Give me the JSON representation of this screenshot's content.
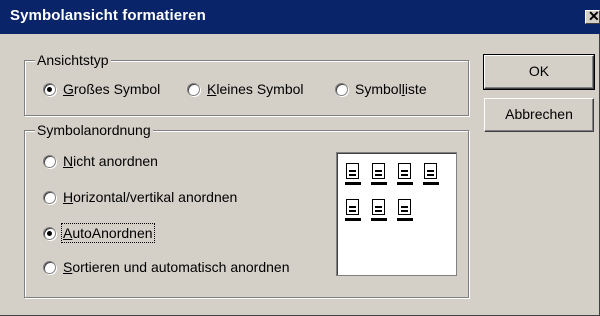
{
  "window": {
    "title": "Symbolansicht formatieren",
    "close_glyph": "✕"
  },
  "view_type": {
    "label": "Ansichtstyp",
    "options": [
      {
        "pre": "",
        "mnemonic": "G",
        "post": "roßes Symbol",
        "checked": true
      },
      {
        "pre": "",
        "mnemonic": "K",
        "post": "leines Symbol",
        "checked": false
      },
      {
        "pre": "Symbol",
        "mnemonic": "l",
        "post": "iste",
        "checked": false
      }
    ]
  },
  "arrangement": {
    "label": "Symbolanordnung",
    "options": [
      {
        "pre": "",
        "mnemonic": "N",
        "post": "icht anordnen",
        "checked": false
      },
      {
        "pre": "",
        "mnemonic": "H",
        "post": "orizontal/vertikal anordnen",
        "checked": false
      },
      {
        "pre": "",
        "mnemonic": "A",
        "post": "utoAnordnen",
        "checked": true
      },
      {
        "pre": "",
        "mnemonic": "S",
        "post": "ortieren und automatisch anordnen",
        "checked": false
      }
    ]
  },
  "buttons": {
    "ok": "OK",
    "cancel": "Abbrechen"
  },
  "preview": {
    "icon": "document-icon",
    "rows": [
      4,
      3
    ]
  },
  "colors": {
    "dialog_bg": "#d4d0c8",
    "titlebar": "#0a246a"
  }
}
